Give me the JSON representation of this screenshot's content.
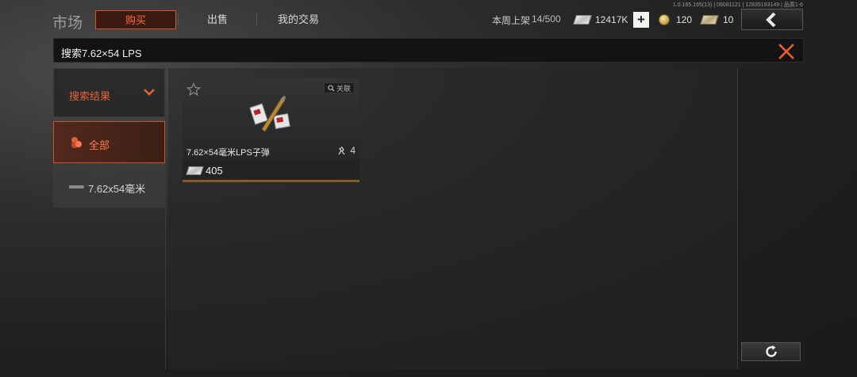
{
  "version_text": "1.0.165.165(13) | 05081121 | 12835193149 | 品质1-6",
  "header": {
    "title": "市场",
    "tabs": [
      {
        "label": "购买",
        "active": true
      },
      {
        "label": "出售",
        "active": false
      },
      {
        "label": "我的交易",
        "active": false
      }
    ],
    "weekly_listing_label": "本周上架",
    "weekly_listing_count": "14/500",
    "currencies": {
      "cash": "12417K",
      "coins": "120",
      "tickets": "10"
    },
    "add_funds_label": "+"
  },
  "search": {
    "query": "搜索7.62×54 LPS"
  },
  "sidebar": {
    "header_label": "搜索结果",
    "items": [
      {
        "label": "全部",
        "active": true,
        "icon": "ammo-stack-icon"
      },
      {
        "label": "7.62x54毫米",
        "active": false,
        "icon": "bullet-icon"
      }
    ]
  },
  "results": [
    {
      "name": "7.62×54毫米LPS子弹",
      "related_label": "关联",
      "stock": "4",
      "price": "405",
      "icon": "ammo-box-icon"
    }
  ],
  "colors": {
    "accent": "#d4572c",
    "accent_text": "#ff7a4a",
    "background": "#1e1e1e"
  }
}
